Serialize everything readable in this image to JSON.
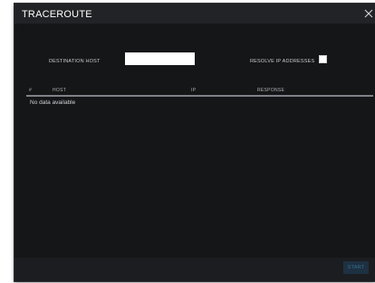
{
  "dialog": {
    "title": "TRACEROUTE",
    "close_icon": "close-icon"
  },
  "form": {
    "destination_label": "DESTINATION HOST",
    "destination_value": "",
    "resolve_label": "RESOLVE IP ADDRESSES",
    "resolve_checked": false
  },
  "table": {
    "columns": {
      "num": "#",
      "host": "HOST",
      "ip": "IP",
      "response": "RESPONSE"
    },
    "empty_message": "No data available"
  },
  "footer": {
    "start_label": "START"
  },
  "colors": {
    "background": "#151618",
    "accent_disabled": "#1d3142"
  }
}
